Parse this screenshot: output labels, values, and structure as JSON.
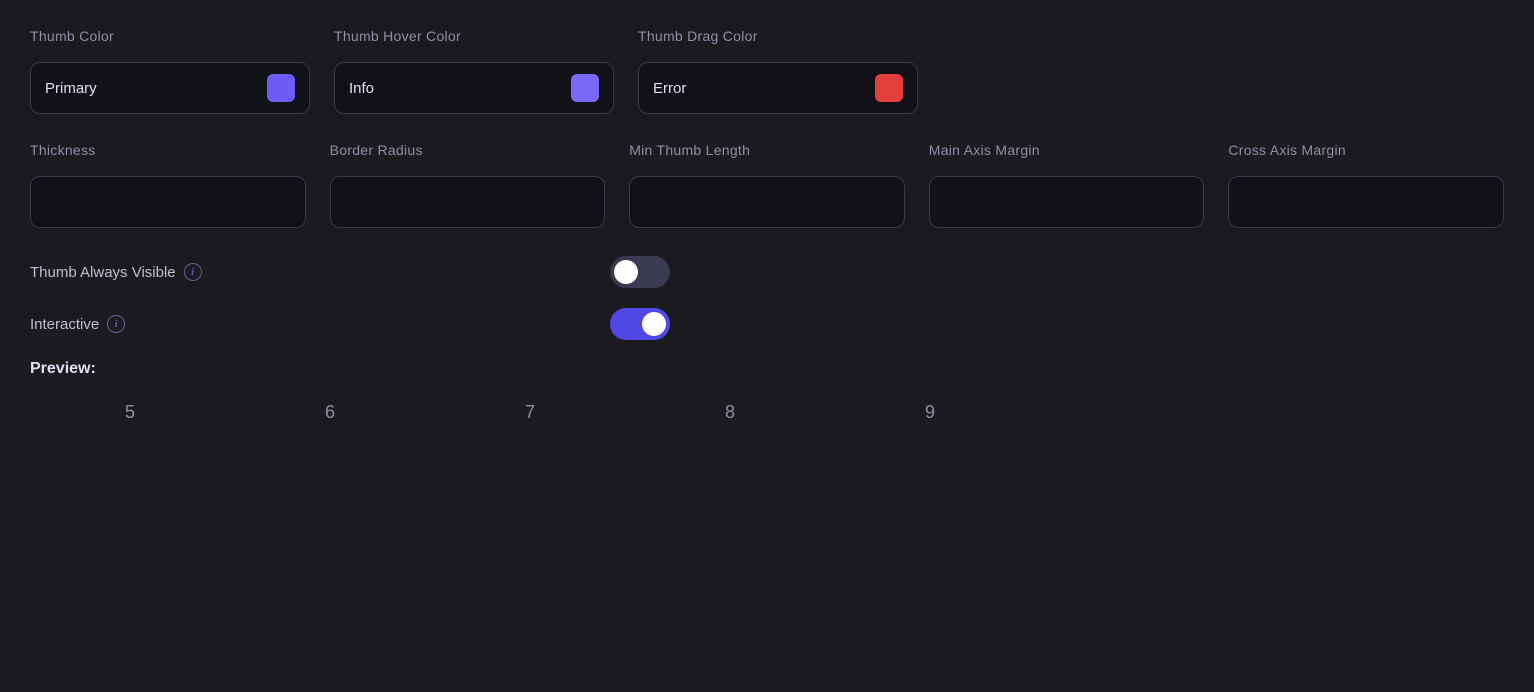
{
  "colors_section": {
    "thumb_color_label": "Thumb Color",
    "thumb_hover_color_label": "Thumb Hover Color",
    "thumb_drag_color_label": "Thumb Drag Color",
    "thumb_color_value": "Primary",
    "thumb_hover_color_value": "Info",
    "thumb_drag_color_value": "Error"
  },
  "inputs_section": {
    "thickness_label": "Thickness",
    "border_radius_label": "Border Radius",
    "min_thumb_length_label": "Min Thumb Length",
    "main_axis_margin_label": "Main Axis Margin",
    "cross_axis_margin_label": "Cross Axis Margin"
  },
  "toggles": {
    "thumb_always_visible_label": "Thumb Always Visible",
    "thumb_always_visible_state": "off",
    "interactive_label": "Interactive",
    "interactive_state": "on",
    "info_icon": "i"
  },
  "preview": {
    "label": "Preview:",
    "numbers": [
      "5",
      "6",
      "7",
      "8",
      "9"
    ]
  }
}
